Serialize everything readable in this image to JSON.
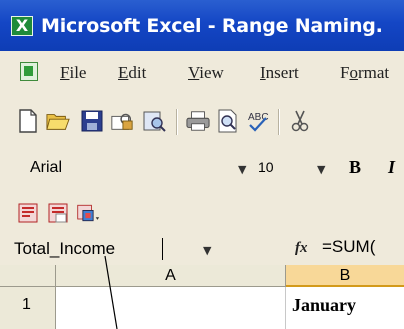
{
  "window": {
    "title": "Microsoft Excel - Range Naming.",
    "app_icon_letter": "X"
  },
  "menubar": {
    "items": [
      {
        "label": "File",
        "underline": "F",
        "rest": "ile"
      },
      {
        "label": "Edit",
        "underline": "E",
        "rest": "dit"
      },
      {
        "label": "View",
        "underline": "V",
        "rest": "iew"
      },
      {
        "label": "Insert",
        "underline": "I",
        "rest": "nsert"
      },
      {
        "label": "Format",
        "pre": "F",
        "underline": "o",
        "rest": "rmat"
      }
    ]
  },
  "toolbar": {
    "icons": [
      "new-icon",
      "open-icon",
      "save-icon",
      "permission-icon",
      "research-icon",
      "print-icon",
      "print-preview-icon",
      "spelling-icon",
      "cut-icon"
    ]
  },
  "format_toolbar": {
    "font": "Arial",
    "size": "10",
    "bold": "B",
    "italic": "I"
  },
  "pdf_toolbar": {
    "icons": [
      "pdf-convert-icon",
      "pdf-email-icon",
      "pdf-review-icon"
    ]
  },
  "formula_bar": {
    "name_box": "Total_Income",
    "fx": "fx",
    "formula": "=SUM("
  },
  "sheet": {
    "column_headers": [
      "A",
      "B"
    ],
    "row_headers": [
      "1"
    ],
    "cells": {
      "B1": "January"
    }
  },
  "colors": {
    "titlebar": "#1446c5",
    "toolbar_bg": "#efeadb",
    "grid_header": "#ece9d8",
    "selected_header": "#f8d898"
  }
}
